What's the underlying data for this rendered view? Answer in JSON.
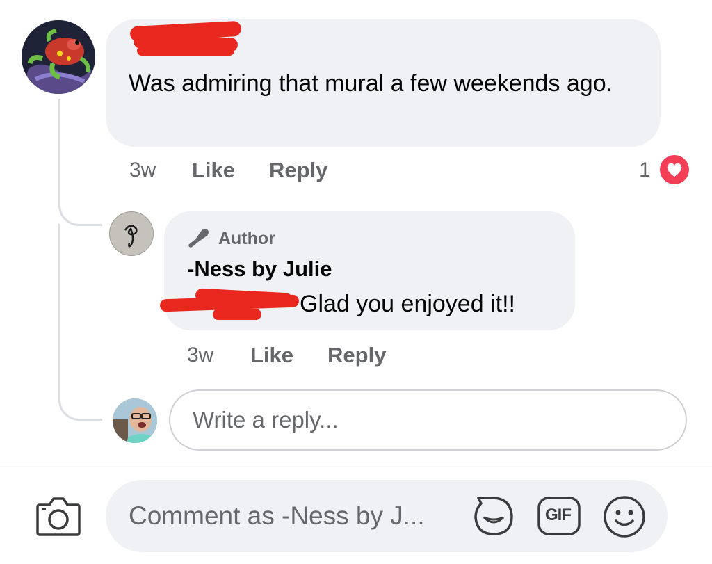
{
  "comment": {
    "text": "Was admiring that mural a few weekends ago.",
    "time": "3w",
    "like_label": "Like",
    "reply_label": "Reply",
    "reaction_count": "1",
    "reaction_icon": "heart-icon",
    "reaction_color": "#f33e58"
  },
  "reply": {
    "badge_label": "Author",
    "author_name": "-Ness by Julie",
    "text": "Glad you enjoyed it!!",
    "time": "3w",
    "like_label": "Like",
    "reply_label": "Reply"
  },
  "reply_input": {
    "placeholder": "Write a reply..."
  },
  "composer": {
    "placeholder": "Comment as -Ness by J...",
    "gif_label": "GIF",
    "icons": [
      "camera-icon",
      "sticker-icon",
      "gif-icon",
      "emoji-icon"
    ]
  }
}
